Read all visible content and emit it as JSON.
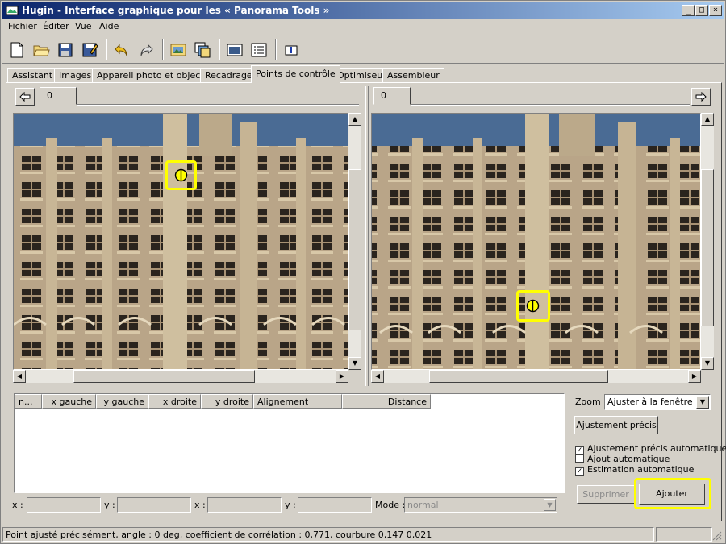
{
  "window": {
    "title": "Hugin - Interface graphique pour les « Panorama Tools »",
    "controls": [
      "minimize-icon",
      "maximize-icon",
      "close-icon"
    ]
  },
  "menu": [
    "Fichier",
    "Éditer",
    "Vue",
    "Aide"
  ],
  "toolbar": {
    "icons": [
      "new-file-icon",
      "open-folder-icon",
      "save-icon",
      "save-as-icon",
      "undo-icon",
      "redo-icon",
      "add-image-icon",
      "add-series-icon",
      "preview-icon",
      "list-icon",
      "info-icon"
    ]
  },
  "tabs": [
    "Assistant",
    "Images",
    "Appareil photo et objectif",
    "Recadrage",
    "Points de contrôle",
    "Optimiseur",
    "Assembleur"
  ],
  "active_tab": "Points de contrôle",
  "left_image": {
    "tab_label": "0"
  },
  "right_image": {
    "tab_label": "0"
  },
  "table": {
    "columns": [
      "n...",
      "x gauche",
      "y gauche",
      "x droite",
      "y droite",
      "Alignement",
      "Distance"
    ],
    "rows": []
  },
  "coords": {
    "x_left_label": "x :",
    "y_left_label": "y :",
    "x_right_label": "x :",
    "y_right_label": "y :",
    "mode_label": "Mode :",
    "mode_value": "normal"
  },
  "zoom": {
    "label": "Zoom :",
    "value": "Ajuster à la fenêtre"
  },
  "buttons": {
    "fine_tune": "Ajustement précis",
    "delete": "Supprimer",
    "add": "Ajouter"
  },
  "options": [
    {
      "label": "Ajustement précis automatique",
      "checked": true
    },
    {
      "label": "Ajout automatique",
      "checked": false
    },
    {
      "label": "Estimation automatique",
      "checked": true
    }
  ],
  "status": "Point ajusté précisément, angle : 0 deg, coefficient de corrélation : 0,771, courbure 0,147 0,021",
  "colors": {
    "highlight": "#ffff00",
    "title_start": "#0a246a",
    "title_end": "#a6caf0",
    "sky": "#4a6b94"
  }
}
